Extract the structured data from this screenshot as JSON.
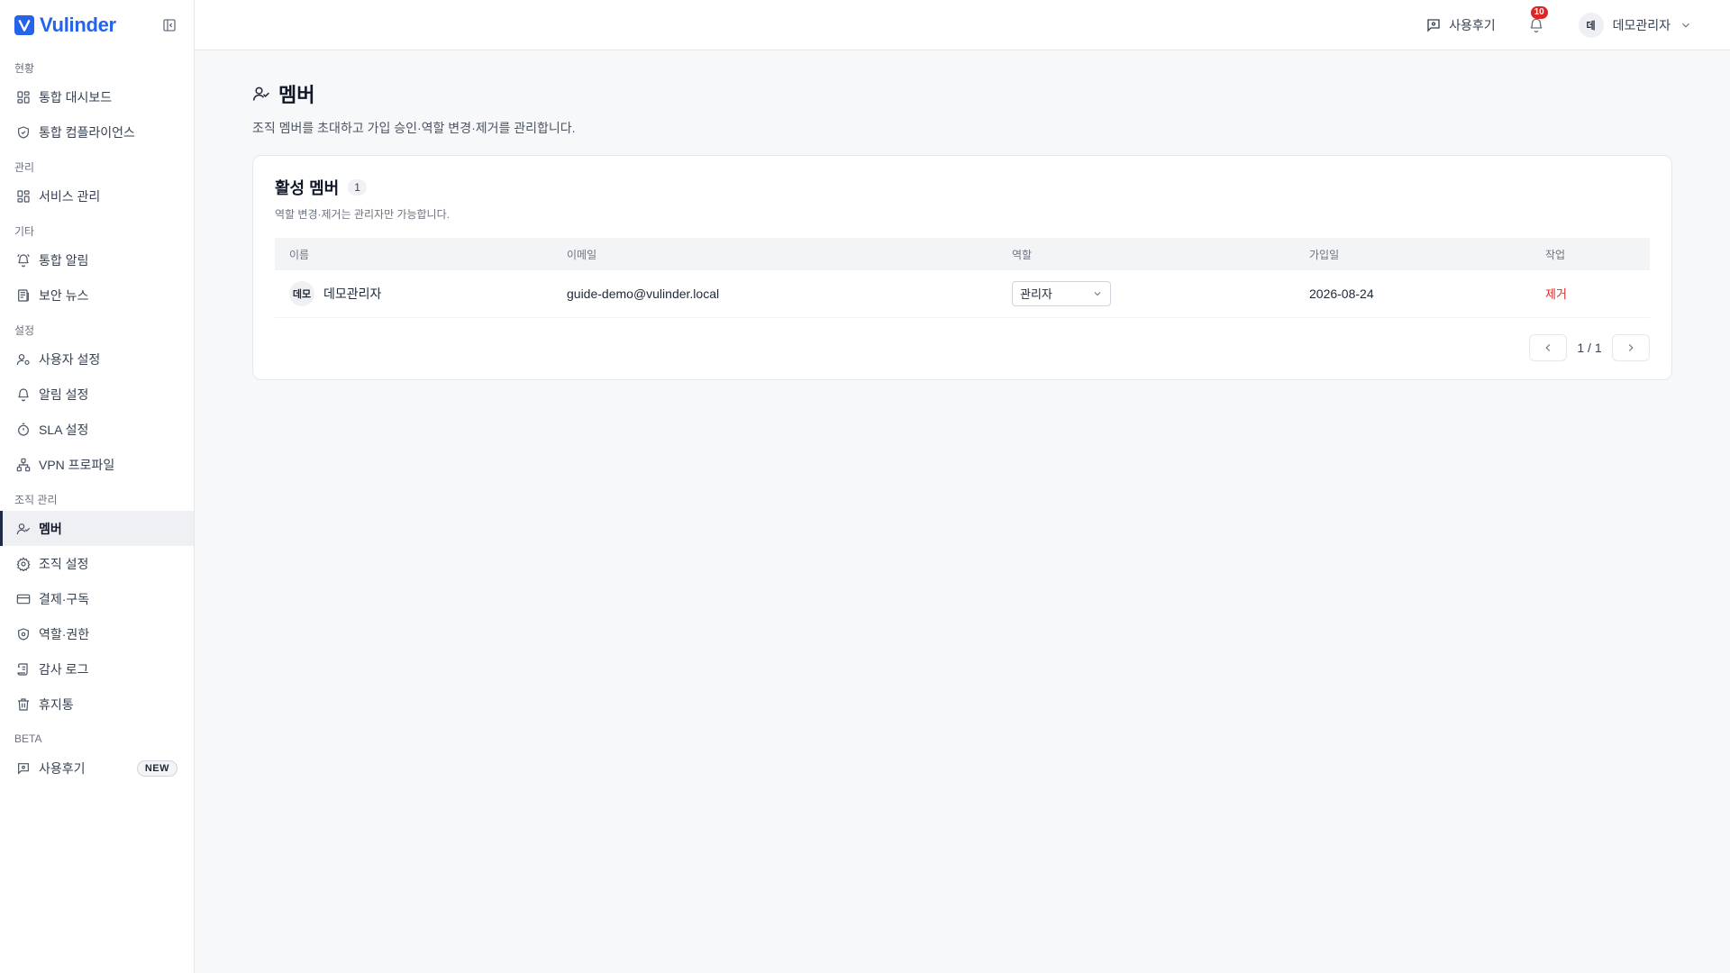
{
  "brand": {
    "name": "Vulinder",
    "logo_letter": "V"
  },
  "sidebar": {
    "sections": [
      {
        "label": "현황",
        "items": [
          {
            "label": "통합 대시보드",
            "icon": "grid-icon"
          },
          {
            "label": "통합 컴플라이언스",
            "icon": "shield-check-icon"
          }
        ]
      },
      {
        "label": "관리",
        "items": [
          {
            "label": "서비스 관리",
            "icon": "grid-icon"
          }
        ]
      },
      {
        "label": "기타",
        "items": [
          {
            "label": "통합 알림",
            "icon": "bell-ring-icon"
          },
          {
            "label": "보안 뉴스",
            "icon": "newspaper-icon"
          }
        ]
      },
      {
        "label": "설정",
        "items": [
          {
            "label": "사용자 설정",
            "icon": "user-cog-icon"
          },
          {
            "label": "알림 설정",
            "icon": "bell-icon"
          },
          {
            "label": "SLA 설정",
            "icon": "timer-icon"
          },
          {
            "label": "VPN 프로파일",
            "icon": "network-icon"
          }
        ]
      },
      {
        "label": "조직 관리",
        "items": [
          {
            "label": "멤버",
            "icon": "user-check-icon",
            "active": true
          },
          {
            "label": "조직 설정",
            "icon": "gear-icon"
          },
          {
            "label": "결제·구독",
            "icon": "credit-card-icon"
          },
          {
            "label": "역할·권한",
            "icon": "shield-gear-icon"
          },
          {
            "label": "감사 로그",
            "icon": "scroll-icon"
          },
          {
            "label": "휴지통",
            "icon": "trash-icon"
          }
        ]
      },
      {
        "label": "BETA",
        "items": [
          {
            "label": "사용후기",
            "icon": "message-icon",
            "badge": "NEW"
          }
        ]
      }
    ]
  },
  "topbar": {
    "review_label": "사용후기",
    "notification_count": "10",
    "user_initial": "데",
    "user_name": "데모관리자"
  },
  "page": {
    "title": "멤버",
    "description": "조직 멤버를 초대하고 가입 승인·역할 변경·제거를 관리합니다."
  },
  "card": {
    "title": "활성 멤버",
    "count": "1",
    "subtitle": "역할 변경·제거는 관리자만 가능합니다.",
    "columns": [
      "이름",
      "이메일",
      "역할",
      "가입일",
      "작업"
    ],
    "rows": [
      {
        "avatar": "데모",
        "name": "데모관리자",
        "email": "guide-demo@vulinder.local",
        "role": "관리자",
        "joined": "2026-08-24",
        "action": "제거"
      }
    ],
    "pagination": "1 / 1"
  },
  "colors": {
    "accent": "#2563eb",
    "danger": "#dc2626",
    "active_bar": "#1f2a44"
  }
}
